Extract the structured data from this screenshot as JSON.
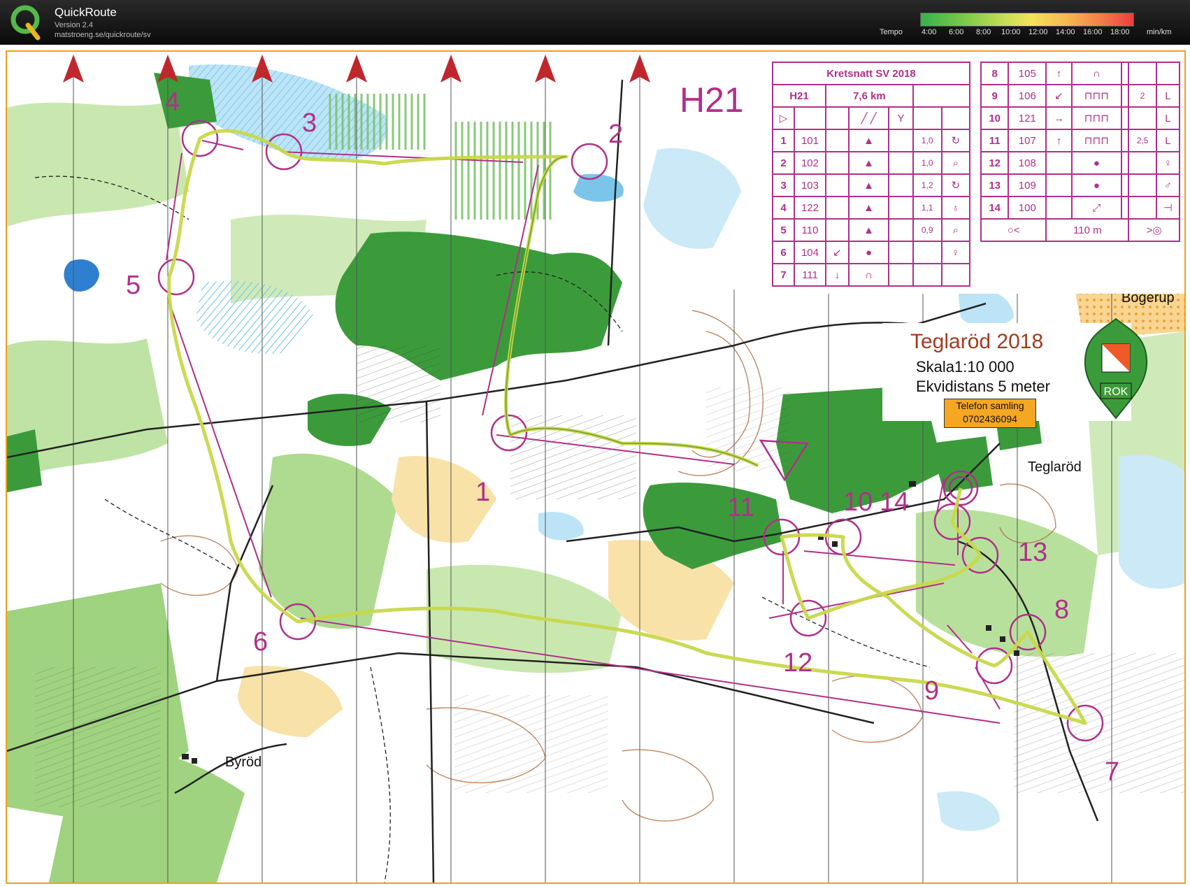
{
  "app": {
    "name": "QuickRoute",
    "version": "Version 2.4",
    "url": "matstroeng.se/quickroute/sv",
    "tempo_label": "Tempo",
    "tempo_ticks": [
      "4:00",
      "6:00",
      "8:00",
      "10:00",
      "12:00",
      "14:00",
      "16:00",
      "18:00"
    ],
    "tempo_unit": "min/km"
  },
  "course": {
    "event": "Kretsnatt SV 2018",
    "class": "H21",
    "length": "7,6 km",
    "map_class_label": "H21",
    "controls_left": [
      {
        "num": "1",
        "code": "101",
        "dir": "",
        "feature": "▲",
        "dim": "1,0",
        "where": "↻"
      },
      {
        "num": "2",
        "code": "102",
        "dir": "",
        "feature": "▲",
        "dim": "1,0",
        "where": "⌕"
      },
      {
        "num": "3",
        "code": "103",
        "dir": "",
        "feature": "▲",
        "dim": "1,2",
        "where": "↻"
      },
      {
        "num": "4",
        "code": "122",
        "dir": "",
        "feature": "▲",
        "dim": "1,1",
        "where": "♁"
      },
      {
        "num": "5",
        "code": "110",
        "dir": "",
        "feature": "▲",
        "dim": "0,9",
        "where": "⌕"
      },
      {
        "num": "6",
        "code": "104",
        "dir": "↙",
        "feature": "●",
        "dim": "",
        "where": "♀"
      },
      {
        "num": "7",
        "code": "111",
        "dir": "↓",
        "feature": "∩",
        "dim": "",
        "where": ""
      }
    ],
    "controls_right": [
      {
        "num": "8",
        "code": "105",
        "dir": "↑",
        "feature": "∩",
        "dim": "",
        "where": ""
      },
      {
        "num": "9",
        "code": "106",
        "dir": "↙",
        "feature": "⊓⊓⊓",
        "dim": "2",
        "where": "L"
      },
      {
        "num": "10",
        "code": "121",
        "dir": "→",
        "feature": "⊓⊓⊓",
        "dim": "",
        "where": "L"
      },
      {
        "num": "11",
        "code": "107",
        "dir": "↑",
        "feature": "⊓⊓⊓",
        "dim": "2,5",
        "where": "L"
      },
      {
        "num": "12",
        "code": "108",
        "dir": "",
        "feature": "●",
        "dim": "",
        "where": "♀"
      },
      {
        "num": "13",
        "code": "109",
        "dir": "",
        "feature": "●",
        "dim": "",
        "where": "♂"
      },
      {
        "num": "14",
        "code": "100",
        "dir": "",
        "feature": "⤢",
        "dim": "",
        "where": "⊣"
      }
    ],
    "finish_distance": "110 m"
  },
  "map_info": {
    "title": "Teglaröd 2018",
    "scale": "Skala1:10 000",
    "contour": "Ekvidistans 5 meter",
    "phone_label": "Telefon samling",
    "phone_number": "0702436094",
    "club_logo_text": "ROK"
  },
  "place_names": {
    "bogerup": "Bögerup",
    "teglarod": "Teglaröd",
    "byrod": "Byröd"
  },
  "control_labels": [
    "1",
    "2",
    "3",
    "4",
    "5",
    "6",
    "7",
    "8",
    "9",
    "10",
    "11",
    "12",
    "13",
    "14"
  ],
  "colors": {
    "overprint": "#b0308a",
    "route": "#c8d84a",
    "forest_green": "#3b9b3b",
    "light_green": "#9fd37f",
    "water_blue": "#6cc2ea",
    "open_yellow": "#f8d68a",
    "titlebar": "#111111",
    "frame": "#f0a020"
  }
}
